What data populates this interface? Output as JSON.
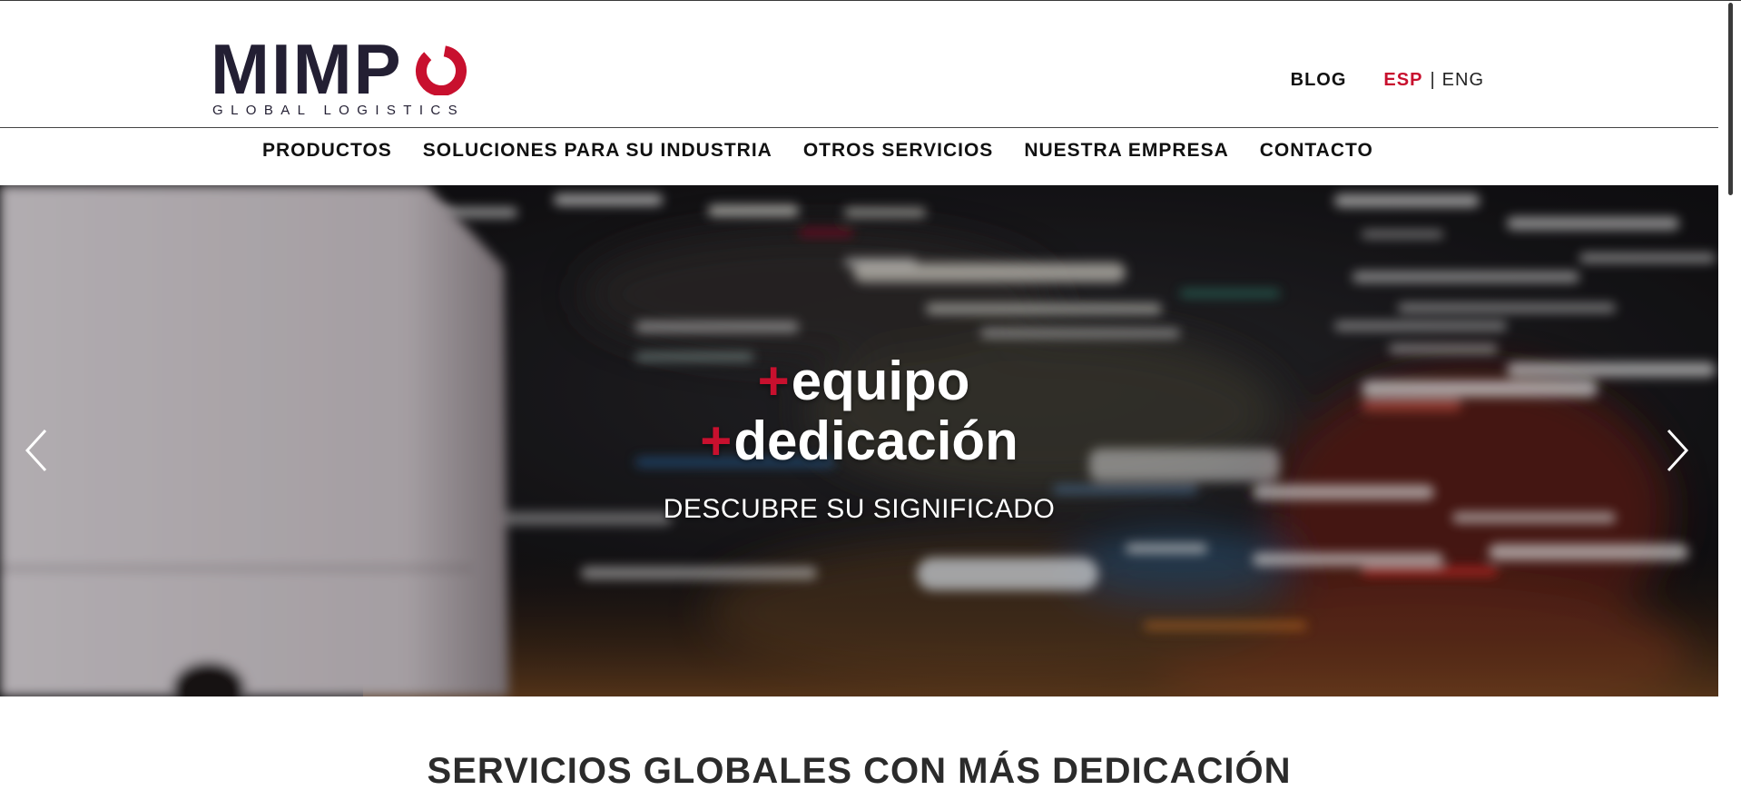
{
  "brand": {
    "logo_text": "MIMPO",
    "logo_word_prefix": "MIMP",
    "logo_tagline": "GLOBAL LOGISTICS",
    "accent_color": "#c8102e",
    "dark_color": "#231f33"
  },
  "header": {
    "blog_label": "BLOG",
    "lang_active": "ESP",
    "lang_separator": "|",
    "lang_other": "ENG"
  },
  "nav": {
    "items": [
      {
        "label": "PRODUCTOS"
      },
      {
        "label": "SOLUCIONES PARA SU INDUSTRIA"
      },
      {
        "label": "OTROS SERVICIOS"
      },
      {
        "label": "NUESTRA EMPRESA"
      },
      {
        "label": "CONTACTO"
      }
    ]
  },
  "hero": {
    "plus_symbol": "+",
    "line1": "equipo",
    "line2": "dedicación",
    "cta": "DESCUBRE SU SIGNIFICADO",
    "prev_icon": "chevron-left-icon",
    "next_icon": "chevron-right-icon"
  },
  "section": {
    "title": "SERVICIOS GLOBALES CON MÁS DEDICACIÓN"
  }
}
